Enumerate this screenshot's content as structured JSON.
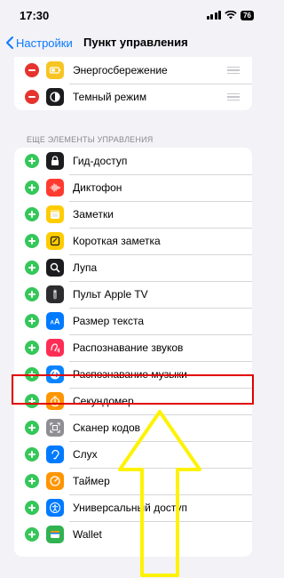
{
  "status_bar": {
    "time": "17:30",
    "battery": "76"
  },
  "nav": {
    "back_label": "Настройки",
    "title": "Пункт управления"
  },
  "included": [
    {
      "label": "Энергосбережение",
      "icon": "battery-icon",
      "color": "#f7c523"
    },
    {
      "label": "Темный режим",
      "icon": "dark-mode-icon",
      "color": "#1c1c1e"
    }
  ],
  "more_controls": {
    "header": "ЕЩЕ ЭЛЕМЕНТЫ УПРАВЛЕНИЯ",
    "items": [
      {
        "label": "Гид-доступ",
        "icon": "lock-icon",
        "color": "#1c1c1e"
      },
      {
        "label": "Диктофон",
        "icon": "waveform-icon",
        "color": "#ff3b30"
      },
      {
        "label": "Заметки",
        "icon": "notes-icon",
        "color": "#ffcc00"
      },
      {
        "label": "Короткая заметка",
        "icon": "quick-note-icon",
        "color": "#ffcc00"
      },
      {
        "label": "Лупа",
        "icon": "magnifier-icon",
        "color": "#1c1c1e"
      },
      {
        "label": "Пульт Apple TV",
        "icon": "remote-icon",
        "color": "#2c2c2e"
      },
      {
        "label": "Размер текста",
        "icon": "text-size-icon",
        "color": "#007aff"
      },
      {
        "label": "Распознавание звуков",
        "icon": "sound-recognition-icon",
        "color": "#ff2d55"
      },
      {
        "label": "Распознавание музыки",
        "icon": "shazam-icon",
        "color": "#0a84ff"
      },
      {
        "label": "Секундомер",
        "icon": "stopwatch-icon",
        "color": "#ff9500"
      },
      {
        "label": "Сканер кодов",
        "icon": "qr-code-icon",
        "color": "#8e8e93"
      },
      {
        "label": "Слух",
        "icon": "ear-icon",
        "color": "#007aff"
      },
      {
        "label": "Таймер",
        "icon": "timer-icon",
        "color": "#ff9500"
      },
      {
        "label": "Универсальный доступ",
        "icon": "accessibility-icon",
        "color": "#007aff"
      },
      {
        "label": "Wallet",
        "icon": "wallet-icon",
        "color": "#30b350"
      }
    ]
  },
  "annotations": {
    "highlight_color": "#e10000",
    "arrow_color": "#fff200"
  }
}
